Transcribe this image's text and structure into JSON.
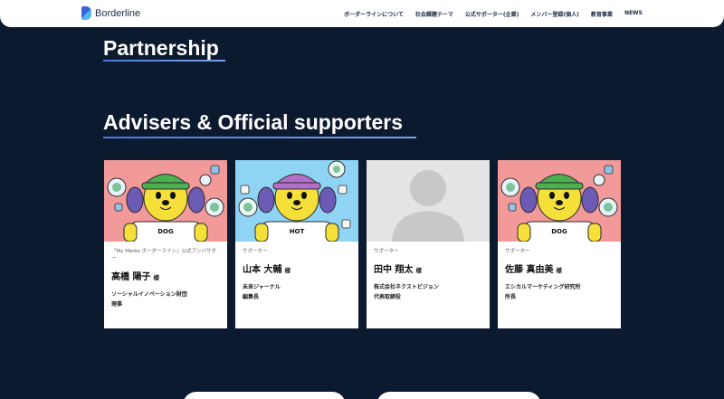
{
  "header": {
    "logo_text": "Borderline",
    "nav": [
      "ボーダーラインについて",
      "社会課題テーマ",
      "公式サポーター(企業)",
      "メンバー登録(個人)",
      "教育事業",
      "NEWS"
    ]
  },
  "sections": {
    "partnership_title": "Partnership",
    "advisers_title": "Advisers & Official supporters"
  },
  "cards": [
    {
      "role": "『My Media ボーダーライン』公式アンバサダー",
      "name": "高橋 陽子",
      "honorific": "様",
      "org_lines": [
        "ソーシャルイノベーション財団",
        "理事"
      ],
      "image": "mascot-dog",
      "badge": "DOG",
      "bg": "#f29a9a",
      "hat": "#4caf50"
    },
    {
      "role": "サポーター",
      "name": "山本 大輔",
      "honorific": "様",
      "org_lines": [
        "未来ジャーナル",
        "編集長"
      ],
      "image": "mascot-hot",
      "badge": "HOT",
      "bg": "#8fd3f5",
      "hat": "#b36fc7"
    },
    {
      "role": "サポーター",
      "name": "田中 翔太",
      "honorific": "様",
      "org_lines": [
        "株式会社ネクストビジョン",
        "代表取締役"
      ],
      "image": "placeholder-avatar",
      "badge": "",
      "bg": "#e4e4e4",
      "hat": ""
    },
    {
      "role": "サポーター",
      "name": "佐藤 真由美",
      "honorific": "様",
      "org_lines": [
        "エシカルマーケティング研究所",
        "所長"
      ],
      "image": "mascot-dog",
      "badge": "DOG",
      "bg": "#f29a9a",
      "hat": "#4caf50"
    }
  ]
}
